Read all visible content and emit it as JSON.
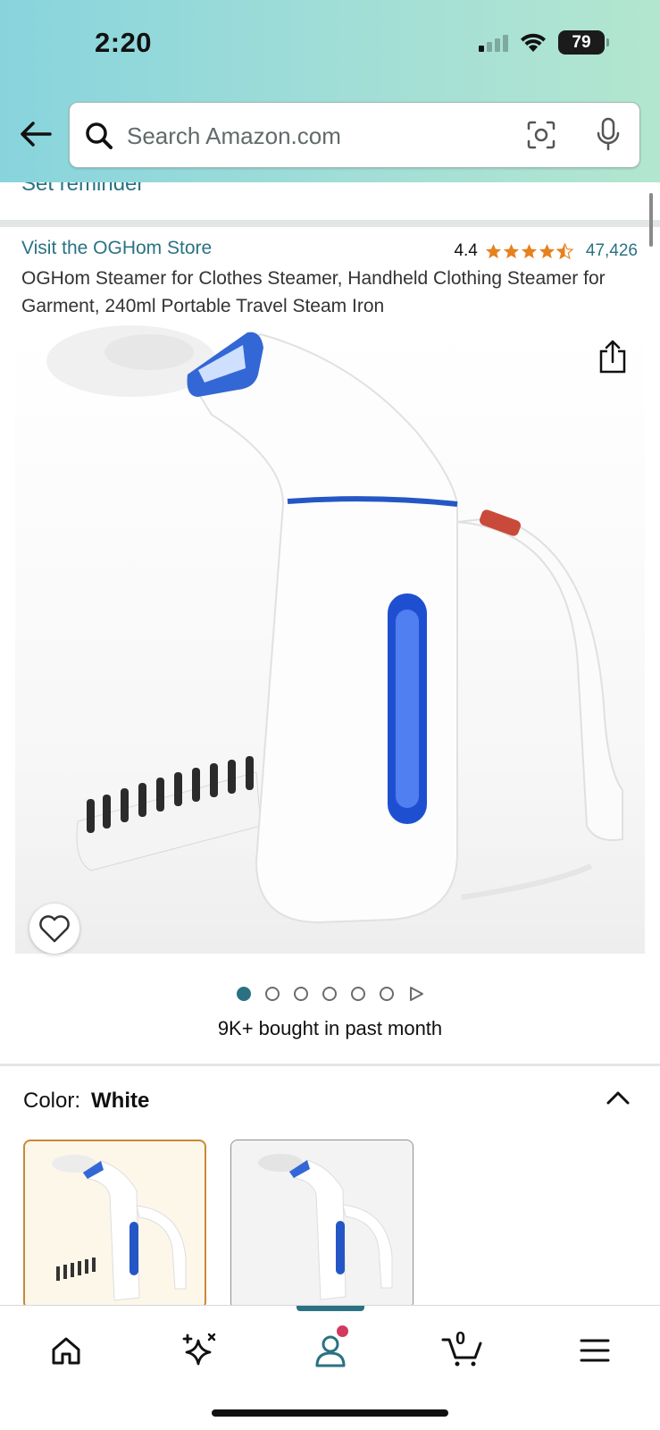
{
  "status_bar": {
    "time": "2:20",
    "battery": "79"
  },
  "search": {
    "placeholder": "Search Amazon.com"
  },
  "reminder": {
    "label": "Set reminder"
  },
  "product": {
    "store_link": "Visit the OGHom Store",
    "rating_value": "4.4",
    "rating_stars": 4.5,
    "rating_count": "47,426",
    "title": "OGHom Steamer for Clothes Steamer, Handheld Clothing Steamer for Garment, 240ml Portable Travel Steam Iron",
    "image_count": 6,
    "active_image": 1,
    "bought_text": "9K+ bought in past month"
  },
  "color_section": {
    "label": "Color:",
    "selected_value": "White"
  },
  "bottom_nav": {
    "cart_count": "0",
    "items": [
      "home-icon",
      "ai-sparkle-icon",
      "account-icon",
      "cart-icon",
      "menu-icon"
    ]
  },
  "colors": {
    "accent": "#2a7283",
    "star": "#e7811f",
    "notify": "#d13a5f"
  }
}
